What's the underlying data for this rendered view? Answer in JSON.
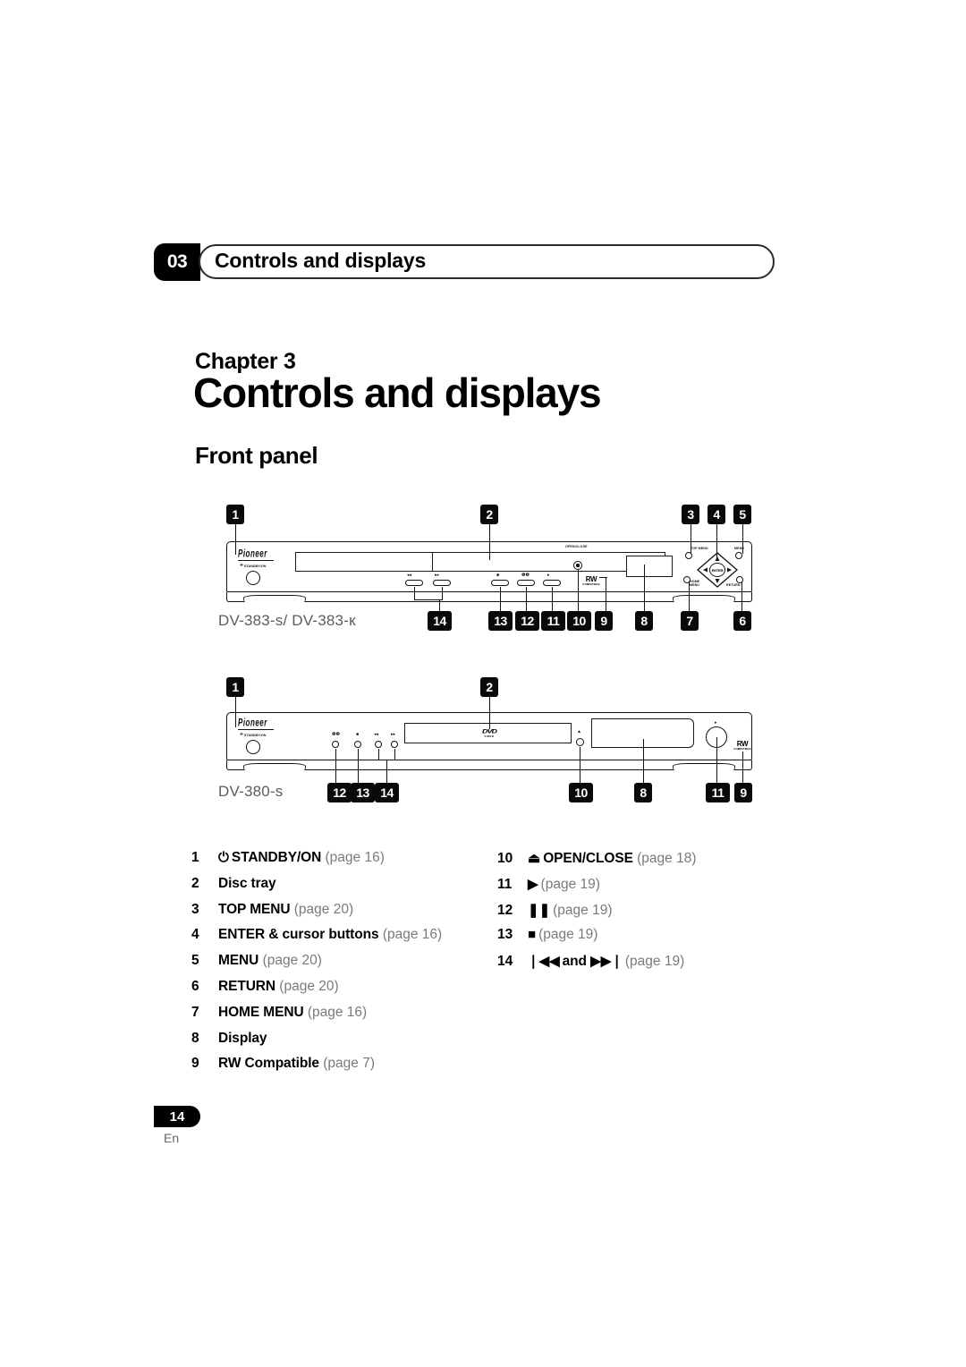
{
  "header": {
    "chapter_number": "03",
    "running_title": "Controls and displays"
  },
  "title_block": {
    "chapter_label": "Chapter 3",
    "page_title": "Controls and displays",
    "section_title": "Front panel"
  },
  "devices": [
    {
      "model_label": "DV-383-s/ DV-383-к",
      "brand": "Pioneer",
      "labels": {
        "standby": "STANDBY/ON",
        "open_close": "OPEN/CLOSE",
        "top_menu": "TOP MENU",
        "menu": "MENU",
        "home_menu": "HOME MENU",
        "return": "RETURN",
        "enter": "ENTER",
        "rw_big": "RW",
        "rw_small": "COMPATIBLE"
      },
      "button_glyphs": {
        "prev": "◂◂",
        "next": "▸▸",
        "stop": "■",
        "pause": "❚❚",
        "play": "▸"
      },
      "callouts_top": [
        "1",
        "2",
        "3",
        "4",
        "5"
      ],
      "callouts_bottom": [
        "14",
        "13",
        "12",
        "11",
        "10",
        "9",
        "8",
        "7",
        "6"
      ]
    },
    {
      "model_label": "DV-380-s",
      "brand": "Pioneer",
      "labels": {
        "standby": "STANDBY/ON",
        "rw_big": "RW",
        "rw_small": "COMPATIBLE",
        "dvd_big": "DVD",
        "dvd_small": "VIDEO"
      },
      "button_glyphs": {
        "pause": "❚❚",
        "stop": "■",
        "prev": "◂◂",
        "next": "▸▸",
        "eject": "▲",
        "play": "▸"
      },
      "callouts_top": [
        "1",
        "2"
      ],
      "callouts_bottom": [
        "12",
        "13",
        "14",
        "10",
        "8",
        "11",
        "9"
      ]
    }
  ],
  "legend": {
    "left": [
      {
        "num": "1",
        "symbol": "⏻",
        "name": "STANDBY/ON",
        "page": "(page 16)"
      },
      {
        "num": "2",
        "symbol": "",
        "name": "Disc tray",
        "page": ""
      },
      {
        "num": "3",
        "symbol": "",
        "name": "TOP MENU",
        "page": "(page 20)"
      },
      {
        "num": "4",
        "symbol": "",
        "name": "ENTER & cursor buttons",
        "page": "(page 16)"
      },
      {
        "num": "5",
        "symbol": "",
        "name": "MENU",
        "page": "(page 20)"
      },
      {
        "num": "6",
        "symbol": "",
        "name": "RETURN",
        "page": "(page 20)"
      },
      {
        "num": "7",
        "symbol": "",
        "name": "HOME MENU",
        "page": "(page 16)"
      },
      {
        "num": "8",
        "symbol": "",
        "name": "Display",
        "page": ""
      },
      {
        "num": "9",
        "symbol": "",
        "name": "RW Compatible",
        "page": "(page 7)"
      }
    ],
    "right": [
      {
        "num": "10",
        "symbol": "⏏",
        "name": "OPEN/CLOSE",
        "page": "(page 18)"
      },
      {
        "num": "11",
        "symbol": "▶",
        "name": "",
        "page": "(page 19)"
      },
      {
        "num": "12",
        "symbol": "❚❚",
        "name": "",
        "page": "(page 19)"
      },
      {
        "num": "13",
        "symbol": "■",
        "name": "",
        "page": "(page 19)"
      },
      {
        "num": "14",
        "symbol": "◀◀",
        "name": "and",
        "symbol2": "▶▶",
        "page": "(page 19)"
      }
    ]
  },
  "footer": {
    "page_number": "14",
    "language": "En"
  }
}
